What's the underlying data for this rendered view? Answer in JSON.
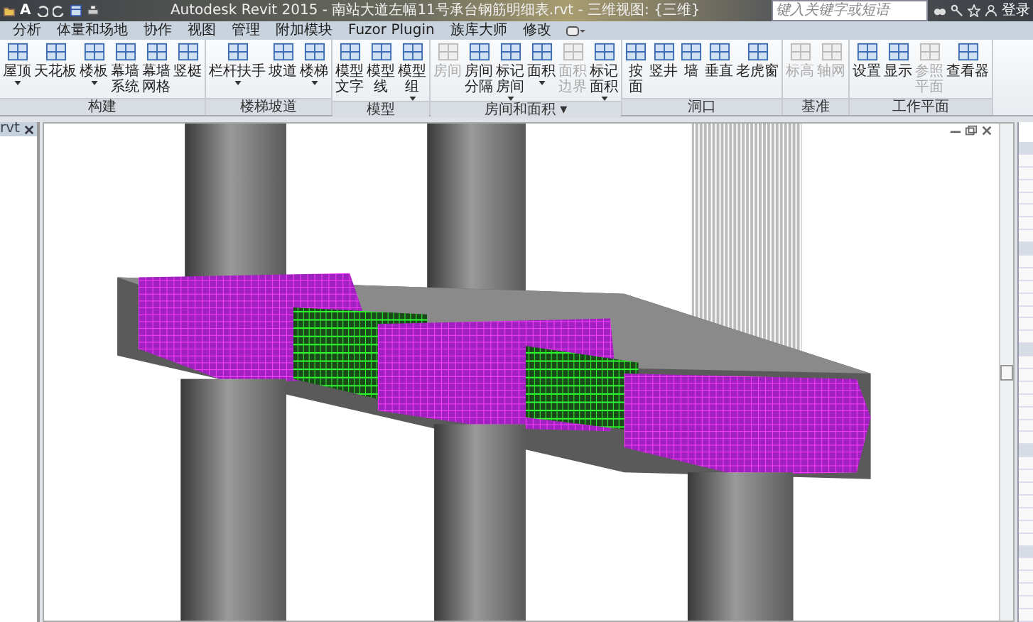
{
  "title_bar": {
    "quick_access_text": "A",
    "title": "Autodesk Revit 2015 -    南站大道左幅11号承台钢筋明细表.rvt - 三维视图: {三维}",
    "search": {
      "placeholder": "键入关键字或短语"
    },
    "sign_in": "登录"
  },
  "tabs": [
    {
      "label": "分析",
      "selected": false
    },
    {
      "label": "体量和场地",
      "selected": false
    },
    {
      "label": "协作",
      "selected": false
    },
    {
      "label": "视图",
      "selected": false
    },
    {
      "label": "管理",
      "selected": false
    },
    {
      "label": "附加模块",
      "selected": false
    },
    {
      "label": "Fuzor Plugin",
      "selected": false
    },
    {
      "label": "族库大师",
      "selected": false
    },
    {
      "label": "修改",
      "selected": false
    }
  ],
  "ribbon": [
    {
      "label": "构建",
      "items": [
        {
          "lines": [
            "屋顶"
          ],
          "disabled": false,
          "dropdown": true
        },
        {
          "lines": [
            "天花板"
          ],
          "disabled": false,
          "dropdown": false
        },
        {
          "lines": [
            "楼板"
          ],
          "disabled": false,
          "dropdown": true
        },
        {
          "lines": [
            "幕墙",
            "系统"
          ],
          "disabled": false,
          "dropdown": false
        },
        {
          "lines": [
            "幕墙",
            "网格"
          ],
          "disabled": false,
          "dropdown": false
        },
        {
          "lines": [
            "竖梃"
          ],
          "disabled": false,
          "dropdown": false
        }
      ]
    },
    {
      "label": "楼梯坡道",
      "items": [
        {
          "lines": [
            "栏杆扶手"
          ],
          "disabled": false,
          "dropdown": true
        },
        {
          "lines": [
            "坡道"
          ],
          "disabled": false,
          "dropdown": false
        },
        {
          "lines": [
            "楼梯"
          ],
          "disabled": false,
          "dropdown": true
        }
      ]
    },
    {
      "label": "模型",
      "items": [
        {
          "lines": [
            "模型",
            "文字"
          ],
          "disabled": false,
          "dropdown": false
        },
        {
          "lines": [
            "模型",
            "线"
          ],
          "disabled": false,
          "dropdown": false
        },
        {
          "lines": [
            "模型",
            "组"
          ],
          "disabled": false,
          "dropdown": true
        }
      ]
    },
    {
      "label": "房间和面积 ▾",
      "items": [
        {
          "lines": [
            "房间"
          ],
          "disabled": true,
          "dropdown": false
        },
        {
          "lines": [
            "房间",
            "分隔"
          ],
          "disabled": false,
          "dropdown": false
        },
        {
          "lines": [
            "标记",
            "房间"
          ],
          "disabled": false,
          "dropdown": true
        },
        {
          "lines": [
            "面积"
          ],
          "disabled": false,
          "dropdown": true
        },
        {
          "lines": [
            "面积",
            "边界"
          ],
          "disabled": true,
          "dropdown": false
        },
        {
          "lines": [
            "标记",
            "面积"
          ],
          "disabled": false,
          "dropdown": true
        }
      ]
    },
    {
      "label": "洞口",
      "items": [
        {
          "lines": [
            "按",
            "面"
          ],
          "disabled": false,
          "dropdown": false
        },
        {
          "lines": [
            "竖井"
          ],
          "disabled": false,
          "dropdown": false
        },
        {
          "lines": [
            "墙"
          ],
          "disabled": false,
          "dropdown": false
        },
        {
          "lines": [
            "垂直"
          ],
          "disabled": false,
          "dropdown": false
        },
        {
          "lines": [
            "老虎窗"
          ],
          "disabled": false,
          "dropdown": false
        }
      ]
    },
    {
      "label": "基准",
      "items": [
        {
          "lines": [
            "标高"
          ],
          "disabled": true,
          "dropdown": false
        },
        {
          "lines": [
            "轴网"
          ],
          "disabled": true,
          "dropdown": false
        }
      ]
    },
    {
      "label": "工作平面",
      "items": [
        {
          "lines": [
            "设置"
          ],
          "disabled": false,
          "dropdown": false
        },
        {
          "lines": [
            "显示"
          ],
          "disabled": false,
          "dropdown": false
        },
        {
          "lines": [
            "参照",
            "平面"
          ],
          "disabled": true,
          "dropdown": false
        },
        {
          "lines": [
            "查看器"
          ],
          "disabled": false,
          "dropdown": false
        }
      ]
    }
  ],
  "left_panel": {
    "tab_label": "rvt"
  }
}
